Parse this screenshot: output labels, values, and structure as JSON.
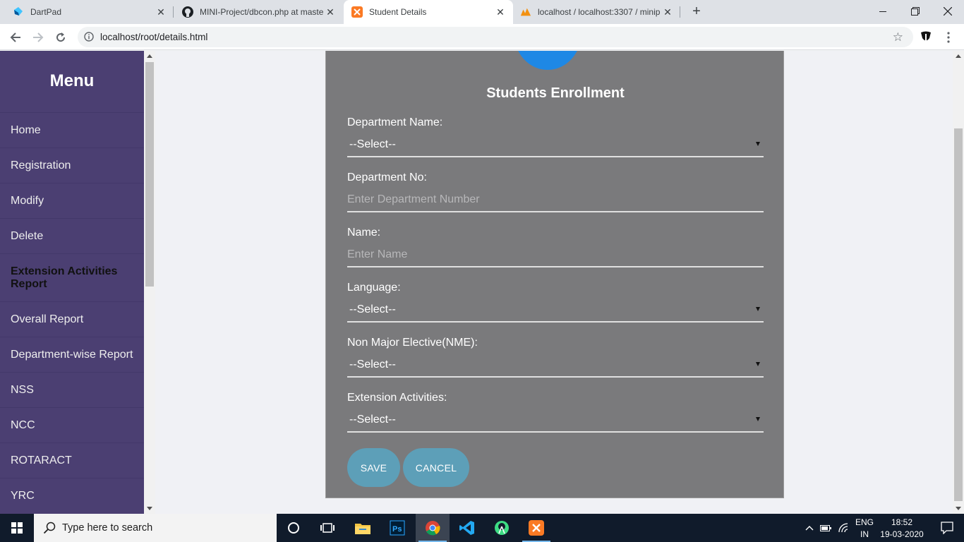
{
  "browser": {
    "tabs": [
      {
        "title": "DartPad",
        "icon": "dartpad-icon",
        "active": false
      },
      {
        "title": "MINI-Project/dbcon.php at maste",
        "icon": "github-icon",
        "active": false
      },
      {
        "title": "Student Details",
        "icon": "xampp-icon",
        "active": true
      },
      {
        "title": "localhost / localhost:3307 / minip",
        "icon": "phpmyadmin-icon",
        "active": false
      }
    ],
    "url": "localhost/root/details.html"
  },
  "sidebar": {
    "title": "Menu",
    "items": [
      {
        "label": "Home"
      },
      {
        "label": "Registration"
      },
      {
        "label": "Modify"
      },
      {
        "label": "Delete"
      },
      {
        "label": "Extension Activities Report",
        "active": true
      },
      {
        "label": "Overall Report"
      },
      {
        "label": "Department-wise Report"
      },
      {
        "label": "NSS"
      },
      {
        "label": "NCC"
      },
      {
        "label": "ROTARACT"
      },
      {
        "label": "YRC"
      }
    ]
  },
  "form": {
    "title": "Students Enrollment",
    "fields": [
      {
        "label": "Department Name:",
        "type": "select",
        "value": "--Select--"
      },
      {
        "label": "Department No:",
        "type": "text",
        "placeholder": "Enter Department Number"
      },
      {
        "label": "Name:",
        "type": "text",
        "placeholder": "Enter Name"
      },
      {
        "label": "Language:",
        "type": "select",
        "value": "--Select--"
      },
      {
        "label": "Non Major Elective(NME):",
        "type": "select",
        "value": "--Select--"
      },
      {
        "label": "Extension Activities:",
        "type": "select",
        "value": "--Select--"
      }
    ],
    "save_label": "SAVE",
    "cancel_label": "CANCEL"
  },
  "taskbar": {
    "search_placeholder": "Type here to search",
    "language": "ENG",
    "region": "IN",
    "time": "18:52",
    "date": "19-03-2020"
  },
  "colors": {
    "sidebar": "#4b3f72",
    "card": "#7a7a7c",
    "button": "#5d9fb8",
    "avatar": "#1e88e5"
  }
}
